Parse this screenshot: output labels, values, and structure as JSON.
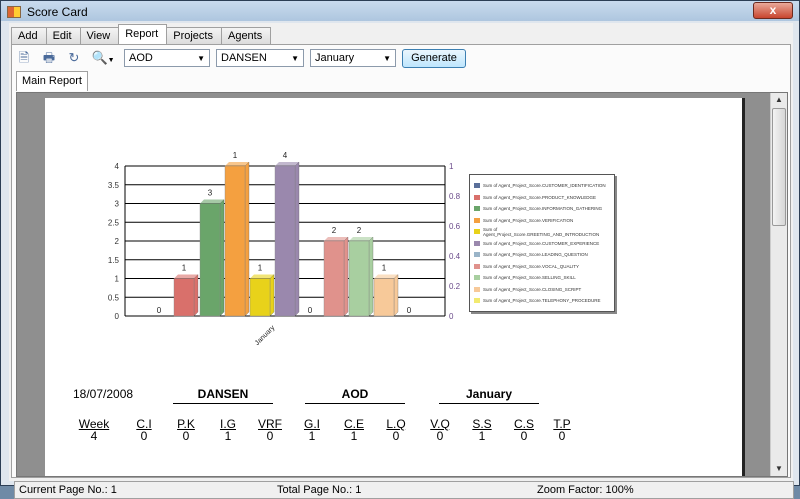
{
  "window": {
    "title": "Score Card",
    "close": "x"
  },
  "tabs": [
    "Add",
    "Edit",
    "View",
    "Report",
    "Projects",
    "Agents"
  ],
  "toolbar": {
    "icons": [
      "export-icon",
      "print-icon",
      "refresh-icon",
      "zoom-icon"
    ],
    "combo_department": "AOD",
    "combo_agent": "DANSEN",
    "combo_month": "January",
    "generate": "Generate"
  },
  "subtab": "Main Report",
  "report": {
    "date": "18/07/2008",
    "agent": "DANSEN",
    "department": "AOD",
    "month": "January",
    "columns": [
      "Week",
      "C.I",
      "P.K",
      "I.G",
      "VRF",
      "G.I",
      "C.E",
      "L.Q",
      "V.Q",
      "S.S",
      "C.S",
      "T.P"
    ],
    "row1": [
      "4",
      "0",
      "0",
      "1",
      "0",
      "1",
      "1",
      "0",
      "0",
      "1",
      "0",
      "0"
    ]
  },
  "chart_data": {
    "type": "bar",
    "category": "January",
    "ylim": [
      0,
      4
    ],
    "yticks": [
      "0",
      "0.5",
      "1",
      "1.5",
      "2",
      "2.5",
      "3",
      "3.5",
      "4"
    ],
    "y2ticks": [
      "0",
      "0.2",
      "0.4",
      "0.6",
      "0.8",
      "1"
    ],
    "series": [
      {
        "name": "Sum of Agent_Project_Score.CUSTOMER_IDENTIFICATION",
        "value": 0,
        "label": "0",
        "color": "#5a6f9a"
      },
      {
        "name": "Sum of Agent_Project_Score.PRODUCT_KNOWLEDGE",
        "value": 1,
        "label": "1",
        "color": "#d9706b"
      },
      {
        "name": "Sum of Agent_Project_Score.INFORMATION_GATHERING",
        "value": 3,
        "label": "3",
        "color": "#6aa56a"
      },
      {
        "name": "Sum of Agent_Project_Score.VERIFICATION",
        "value": 4,
        "label": "1",
        "color": "#f4a040"
      },
      {
        "name": "Sum of Agent_Project_Score.GREETING_AND_INTRODUCTION",
        "value": 1,
        "label": "1",
        "color": "#e8d21a"
      },
      {
        "name": "Sum of Agent_Project_Score.CUSTOMER_EXPERIENCE",
        "value": 4,
        "label": "4",
        "color": "#9a88ad"
      },
      {
        "name": "Sum of Agent_Project_Score.LEADING_QUESTION",
        "value": 0,
        "label": "0",
        "color": "#9ab4c8"
      },
      {
        "name": "Sum of Agent_Project_Score.VOCAL_QUALITY",
        "value": 2,
        "label": "2",
        "color": "#e0928c"
      },
      {
        "name": "Sum of Agent_Project_Score.SELLING_SKILL",
        "value": 2,
        "label": "2",
        "color": "#a8cfa0"
      },
      {
        "name": "Sum of Agent_Project_Score.CLOSING_SCRIPT",
        "value": 1,
        "label": "1",
        "color": "#f7c999"
      },
      {
        "name": "Sum of Agent_Project_Score.TELEPHONY_PROCEDURE",
        "value": 0,
        "label": "0",
        "color": "#f2ea70"
      }
    ]
  },
  "status": {
    "current": "Current Page No.: 1",
    "total": "Total Page No.: 1",
    "zoom": "Zoom Factor: 100%"
  }
}
